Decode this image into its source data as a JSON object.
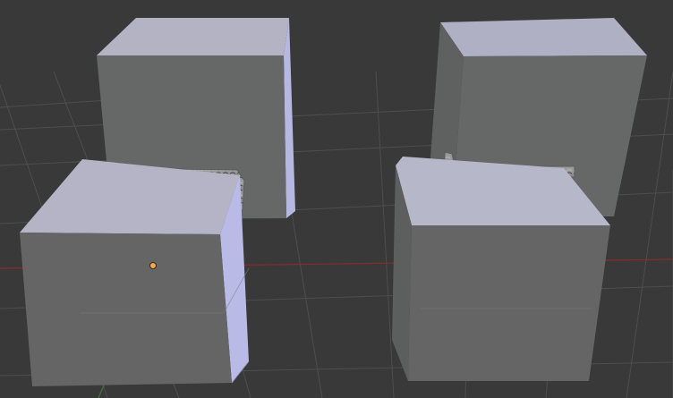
{
  "viewport": {
    "mode": "3d-view",
    "background_color": "#393939",
    "grid_color": "#505050",
    "x_axis_color": "#8c2a2a",
    "y_axis_color": "#3f7a33",
    "origin_color": "#f2a85a"
  },
  "scene": {
    "objects": [
      {
        "name": "cube-back-left",
        "top_color": "#b3b3c4",
        "front_color": "#666767",
        "side_color": "#b6b8e2"
      },
      {
        "name": "cube-back-right",
        "top_color": "#b0b0c4",
        "front_color": "#666767",
        "side_color": "#656666"
      },
      {
        "name": "cube-front-left",
        "top_color": "#b4b4c6",
        "front_color": "#656565",
        "side_color": "#b9bbe6"
      },
      {
        "name": "cube-front-right",
        "top_color": "#b7b7ca",
        "front_color": "#656565",
        "side_color": "#5d5e5e"
      }
    ],
    "weld_beads": [
      {
        "name": "weld-bead-left",
        "color": "#7d7d7d"
      },
      {
        "name": "weld-bead-right",
        "color": "#7d7d7d"
      }
    ]
  }
}
